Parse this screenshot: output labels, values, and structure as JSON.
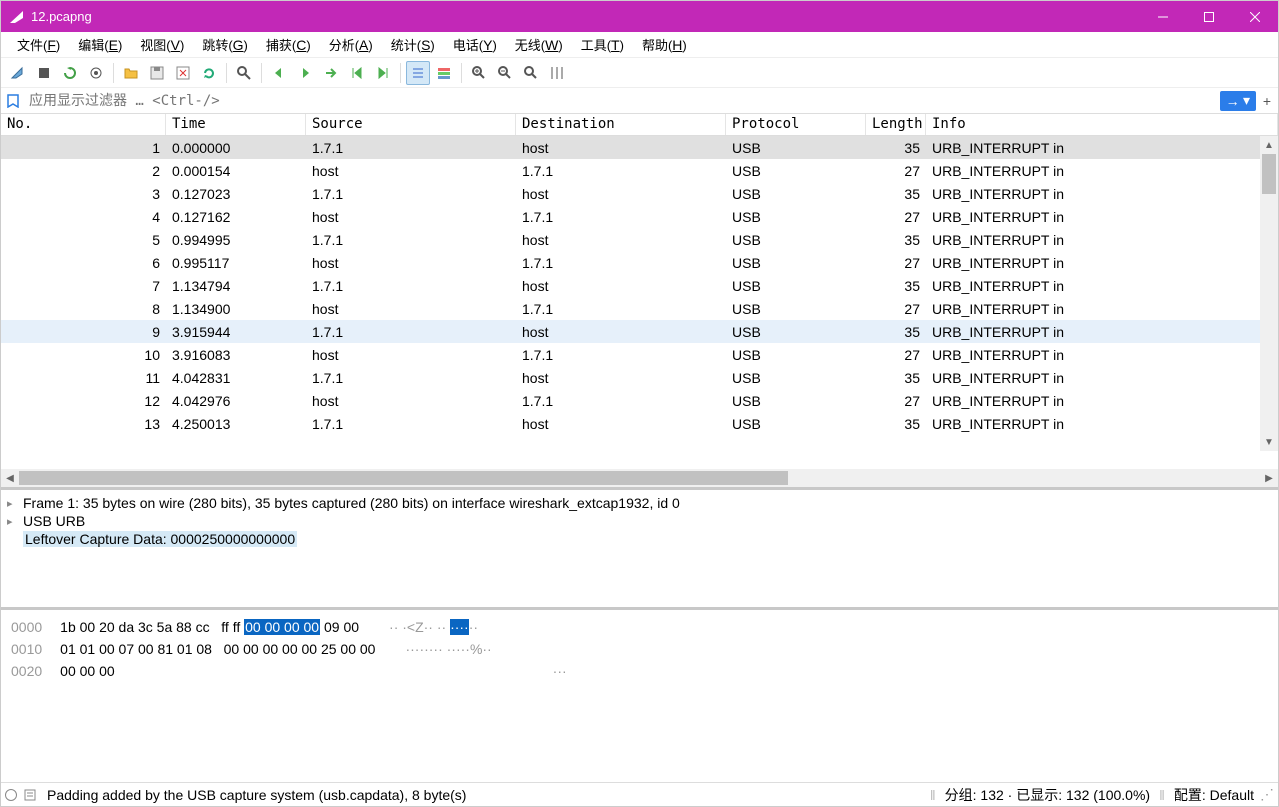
{
  "window": {
    "title": "12.pcapng"
  },
  "menu": [
    "文件(F)",
    "编辑(E)",
    "视图(V)",
    "跳转(G)",
    "捕获(C)",
    "分析(A)",
    "统计(S)",
    "电话(Y)",
    "无线(W)",
    "工具(T)",
    "帮助(H)"
  ],
  "filter": {
    "placeholder": "应用显示过滤器 … <Ctrl-/>"
  },
  "columns": {
    "no": "No.",
    "time": "Time",
    "src": "Source",
    "dst": "Destination",
    "proto": "Protocol",
    "len": "Length",
    "info": "Info"
  },
  "packets": [
    {
      "no": 1,
      "time": "0.000000",
      "src": "1.7.1",
      "dst": "host",
      "proto": "USB",
      "len": 35,
      "info": "URB_INTERRUPT in",
      "sel": true
    },
    {
      "no": 2,
      "time": "0.000154",
      "src": "host",
      "dst": "1.7.1",
      "proto": "USB",
      "len": 27,
      "info": "URB_INTERRUPT in"
    },
    {
      "no": 3,
      "time": "0.127023",
      "src": "1.7.1",
      "dst": "host",
      "proto": "USB",
      "len": 35,
      "info": "URB_INTERRUPT in"
    },
    {
      "no": 4,
      "time": "0.127162",
      "src": "host",
      "dst": "1.7.1",
      "proto": "USB",
      "len": 27,
      "info": "URB_INTERRUPT in"
    },
    {
      "no": 5,
      "time": "0.994995",
      "src": "1.7.1",
      "dst": "host",
      "proto": "USB",
      "len": 35,
      "info": "URB_INTERRUPT in"
    },
    {
      "no": 6,
      "time": "0.995117",
      "src": "host",
      "dst": "1.7.1",
      "proto": "USB",
      "len": 27,
      "info": "URB_INTERRUPT in"
    },
    {
      "no": 7,
      "time": "1.134794",
      "src": "1.7.1",
      "dst": "host",
      "proto": "USB",
      "len": 35,
      "info": "URB_INTERRUPT in"
    },
    {
      "no": 8,
      "time": "1.134900",
      "src": "host",
      "dst": "1.7.1",
      "proto": "USB",
      "len": 27,
      "info": "URB_INTERRUPT in"
    },
    {
      "no": 9,
      "time": "3.915944",
      "src": "1.7.1",
      "dst": "host",
      "proto": "USB",
      "len": 35,
      "info": "URB_INTERRUPT in",
      "hl": true
    },
    {
      "no": 10,
      "time": "3.916083",
      "src": "host",
      "dst": "1.7.1",
      "proto": "USB",
      "len": 27,
      "info": "URB_INTERRUPT in"
    },
    {
      "no": 11,
      "time": "4.042831",
      "src": "1.7.1",
      "dst": "host",
      "proto": "USB",
      "len": 35,
      "info": "URB_INTERRUPT in"
    },
    {
      "no": 12,
      "time": "4.042976",
      "src": "host",
      "dst": "1.7.1",
      "proto": "USB",
      "len": 27,
      "info": "URB_INTERRUPT in"
    },
    {
      "no": 13,
      "time": "4.250013",
      "src": "1.7.1",
      "dst": "host",
      "proto": "USB",
      "len": 35,
      "info": "URB_INTERRUPT in"
    }
  ],
  "detail": {
    "l1": "Frame 1: 35 bytes on wire (280 bits), 35 bytes captured (280 bits) on interface wireshark_extcap1932, id 0",
    "l2": "USB URB",
    "l3": "Leftover Capture Data: 0000250000000000"
  },
  "hex": {
    "r0": {
      "off": "0000",
      "a": "1b 00 20 da 3c 5a 88 cc",
      "b": "ff ff ",
      "sel": "00 00 00 00",
      "c": " 09 00",
      "asc_a": "·· ·<Z·· ·· ",
      "asc_sel": "····",
      "asc_b": "··"
    },
    "r1": {
      "off": "0010",
      "a": "01 01 00 07 00 81 01 08",
      "b": "00 00 00 00 00 25 00 00",
      "asc": "········ ·····%··"
    },
    "r2": {
      "off": "0020",
      "a": "00 00 00",
      "asc": "···"
    }
  },
  "status": {
    "msg": "Padding added by the USB capture system (usb.capdata), 8 byte(s)",
    "group": "分组: 132",
    "dot": "·",
    "shown": "已显示: 132 (100.0%)",
    "profile": "配置: Default"
  },
  "filter_btn": "→",
  "filter_dropdown": "▾",
  "filter_plus": "+"
}
